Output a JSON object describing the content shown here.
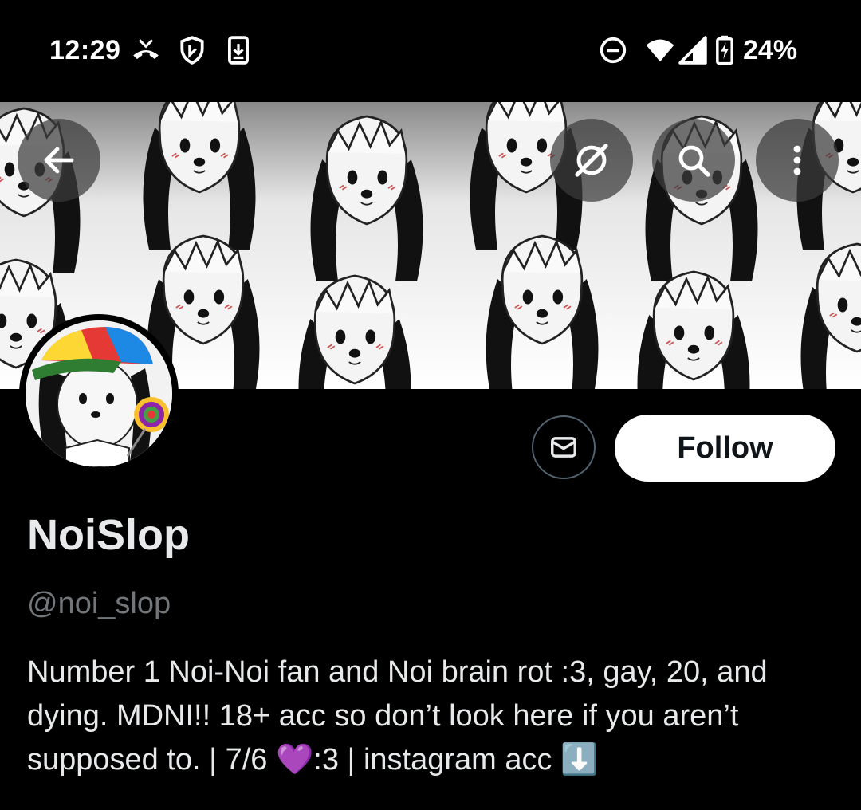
{
  "status_bar": {
    "time": "12:29",
    "battery_text": "24%",
    "icons": [
      "missed-call-icon",
      "shield-icon",
      "download-icon",
      "do-not-disturb-icon",
      "wifi-icon",
      "signal-icon",
      "battery-charging-icon"
    ]
  },
  "header": {
    "back_icon": "arrow-left-icon",
    "translate_icon": "grok-icon",
    "search_icon": "search-icon",
    "more_icon": "more-vertical-icon"
  },
  "profile": {
    "display_name": "NoiSlop",
    "handle": "@noi_slop",
    "bio": "Number 1 Noi-Noi fan and Noi brain rot :3, gay, 20, and dying. MDNI!! 18+ acc so don’t look here if you aren’t supposed to. | 7/6 💜:3 | instagram acc ⬇️",
    "follow_label": "Follow",
    "message_icon": "mail-icon"
  },
  "colors": {
    "background": "#000000",
    "text_primary": "#e7e9ea",
    "text_secondary": "#71767b",
    "follow_bg": "#ffffff"
  }
}
